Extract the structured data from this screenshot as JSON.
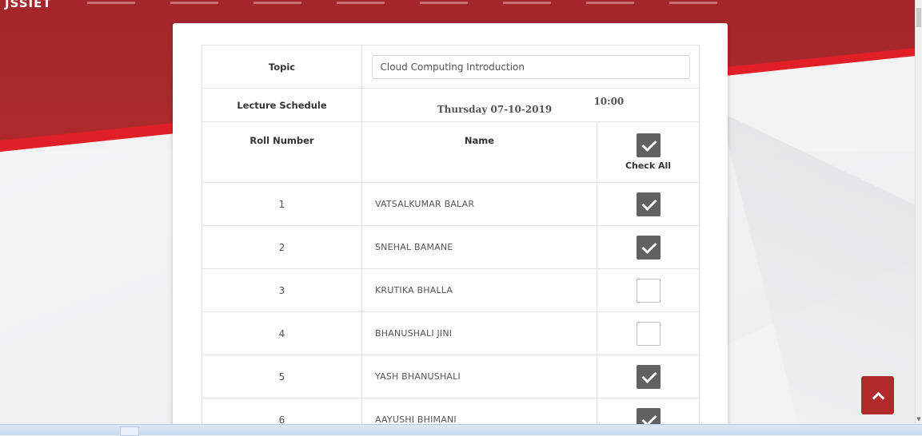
{
  "site": {
    "brand": "JSSIET"
  },
  "form": {
    "topic_label": "Topic",
    "topic_value": "Cloud Computing Introduction",
    "schedule_label": "Lecture Schedule",
    "schedule_day": "Thursday 07-10-2019",
    "schedule_time": "10:00",
    "headers": {
      "roll": "Roll Number",
      "name": "Name",
      "check_all": "Check All"
    },
    "check_all_checked": true
  },
  "students": [
    {
      "roll": "1",
      "name": "VATSALKUMAR  BALAR",
      "present": true
    },
    {
      "roll": "2",
      "name": "SNEHAL  BAMANE",
      "present": true
    },
    {
      "roll": "3",
      "name": "KRUTIKA  BHALLA",
      "present": false
    },
    {
      "roll": "4",
      "name": "BHANUSHALI  JINI",
      "present": false
    },
    {
      "roll": "5",
      "name": "YASH  BHANUSHALI",
      "present": true
    },
    {
      "roll": "6",
      "name": "AAYUSHI  BHIMANI",
      "present": true
    }
  ],
  "icons": {
    "back_to_top": "chevron-up-icon",
    "checkbox": "checkbox-icon"
  },
  "colors": {
    "brand_red": "#a4262a",
    "accent_red": "#e11f26",
    "checkbox_on": "#616161",
    "button_red": "#b02a2b"
  }
}
